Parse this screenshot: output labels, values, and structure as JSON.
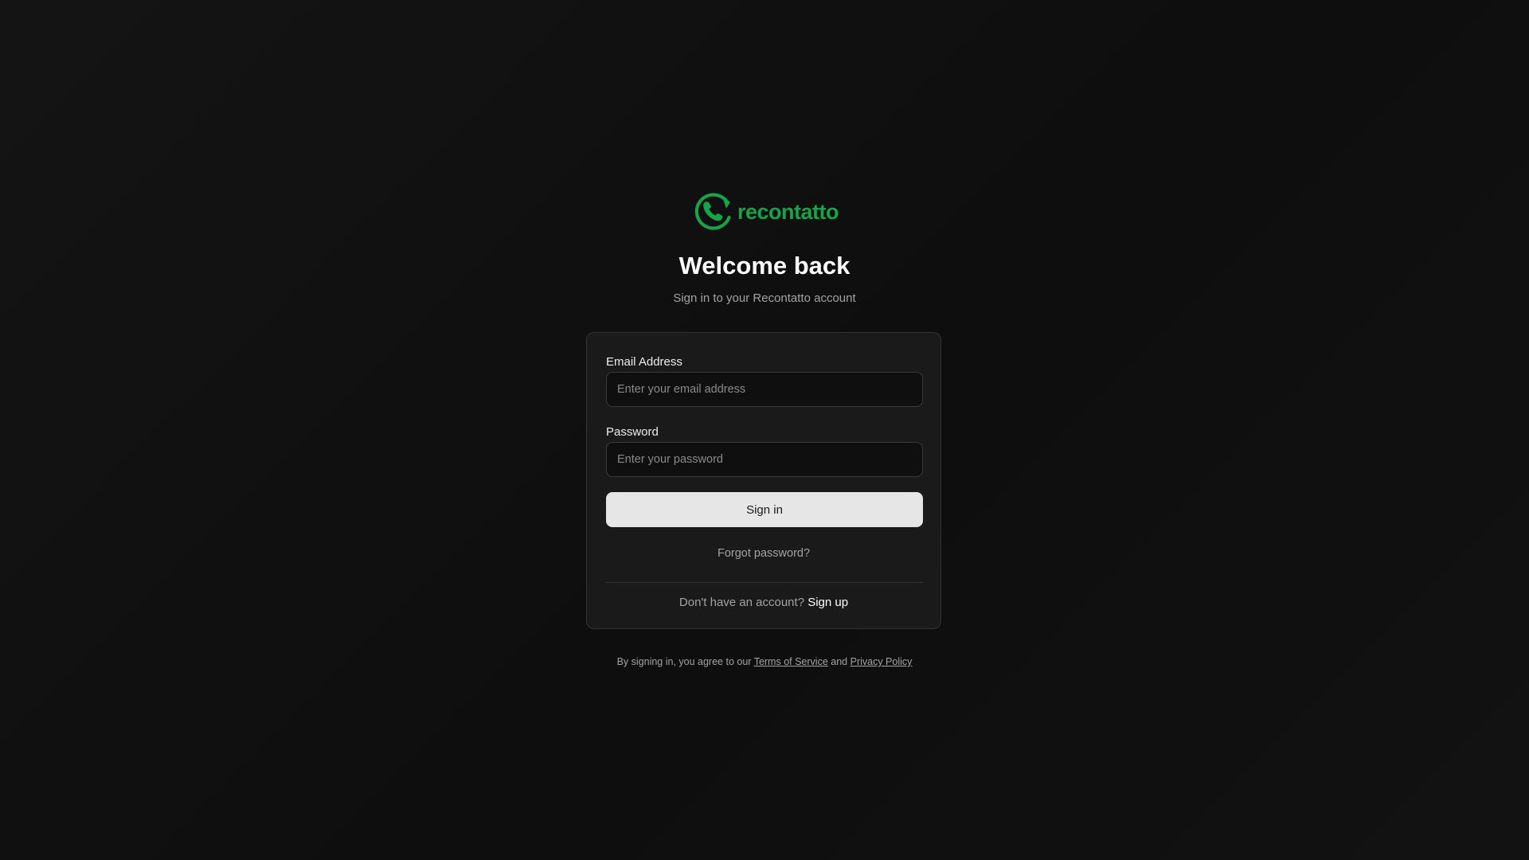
{
  "brand": {
    "name": "recontatto",
    "color": "#16a34a",
    "logo_icon": "phone-refresh-icon"
  },
  "header": {
    "title": "Welcome back",
    "subtitle": "Sign in to your Recontatto account"
  },
  "form": {
    "email": {
      "label": "Email Address",
      "placeholder": "Enter your email address",
      "value": ""
    },
    "password": {
      "label": "Password",
      "placeholder": "Enter your password",
      "value": ""
    },
    "submit_label": "Sign in",
    "forgot_label": "Forgot password?"
  },
  "signup": {
    "prompt": "Don't have an account?",
    "link_label": "Sign up"
  },
  "legal": {
    "prefix": "By signing in, you agree to our",
    "terms_label": "Terms of Service",
    "joiner": "and",
    "privacy_label": "Privacy Policy"
  },
  "colors": {
    "background": "#121212",
    "card": "#1a1a1a",
    "accent": "#16a34a",
    "button": "#e6e6e6"
  }
}
